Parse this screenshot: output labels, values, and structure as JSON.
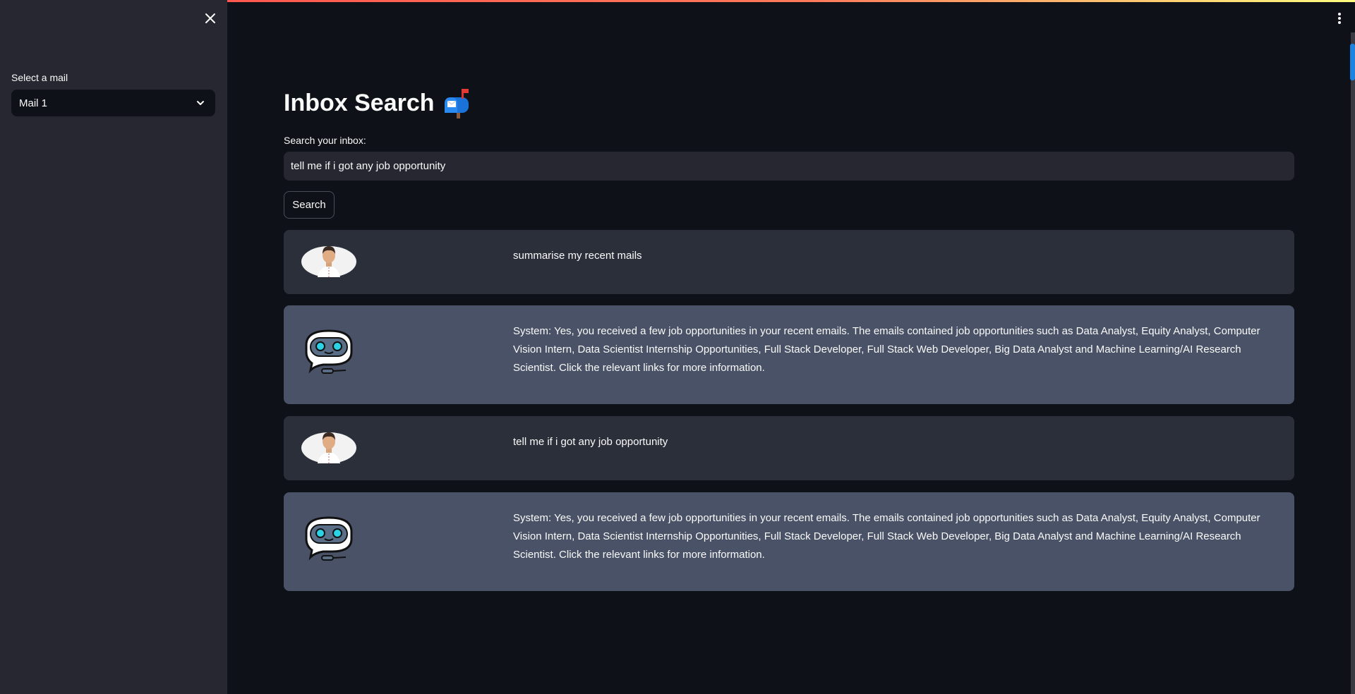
{
  "sidebar": {
    "select_label": "Select a mail",
    "selected_mail": "Mail 1"
  },
  "main": {
    "title": "Inbox Search",
    "title_icon": "mailbox-icon",
    "search_label": "Search your inbox:",
    "search_value": "tell me if i got any job opportunity",
    "search_button": "Search"
  },
  "messages": [
    {
      "role": "user",
      "avatar": "user-avatar-icon",
      "text": "summarise my recent mails"
    },
    {
      "role": "bot",
      "avatar": "robot-avatar-icon",
      "text": "System: Yes, you received a few job opportunities in your recent emails. The emails contained job opportunities such as Data Analyst, Equity Analyst, Computer Vision Intern, Data Scientist Internship Opportunities, Full Stack Developer, Full Stack Web Developer, Big Data Analyst and Machine Learning/AI Research Scientist. Click the relevant links for more information."
    },
    {
      "role": "user",
      "avatar": "user-avatar-icon",
      "text": "tell me if i got any job opportunity"
    },
    {
      "role": "bot",
      "avatar": "robot-avatar-icon",
      "text": "System: Yes, you received a few job opportunities in your recent emails. The emails contained job opportunities such as Data Analyst, Equity Analyst, Computer Vision Intern, Data Scientist Internship Opportunities, Full Stack Developer, Full Stack Web Developer, Big Data Analyst and Machine Learning/AI Research Scientist. Click the relevant links for more information."
    }
  ],
  "colors": {
    "accent_gradient_start": "#ff4b4b",
    "accent_gradient_end": "#fffd80",
    "background": "#0e1117",
    "sidebar": "#262730",
    "user_message_bg": "#2b2f3a",
    "bot_message_bg": "#495266",
    "scrollbar_thumb": "#1c83e1"
  }
}
